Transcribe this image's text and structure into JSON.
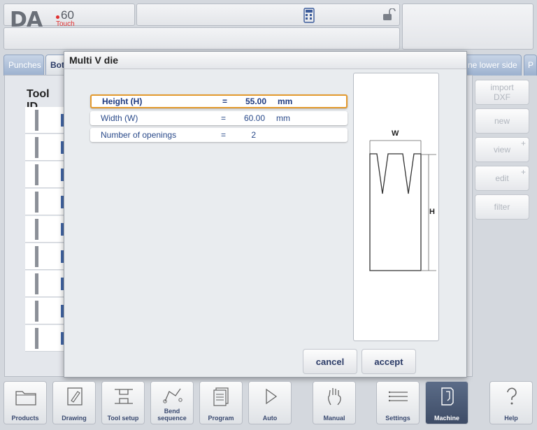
{
  "header": {
    "logo_main": "DA",
    "logo_model": "60",
    "logo_sub": "Touch"
  },
  "tabs": [
    {
      "label": "Punches"
    },
    {
      "label": "Bottom dies"
    },
    {
      "label": "ne lower side"
    },
    {
      "label": "P"
    }
  ],
  "list": {
    "header": "Tool ID"
  },
  "side_buttons": {
    "import": {
      "line1": "import",
      "line2": "DXF"
    },
    "new": "new",
    "view": "view",
    "edit": "edit",
    "filter": "filter"
  },
  "dialog": {
    "title": "Multi V die",
    "fields": [
      {
        "label": "Height (H)",
        "eq": "=",
        "value": "55.00",
        "unit": "mm"
      },
      {
        "label": "Width (W)",
        "eq": "=",
        "value": "60.00",
        "unit": "mm"
      },
      {
        "label": "Number of openings",
        "eq": "=",
        "value": "2",
        "unit": ""
      }
    ],
    "drawing": {
      "width_label": "W",
      "height_label": "H"
    },
    "cancel": "cancel",
    "accept": "accept"
  },
  "bottom_nav": [
    {
      "label": "Products",
      "icon": "folder-icon"
    },
    {
      "label": "Drawing",
      "icon": "drawing-icon"
    },
    {
      "label": "Tool setup",
      "icon": "tool-setup-icon"
    },
    {
      "label1": "Bend",
      "label2": "sequence",
      "icon": "bend-sequence-icon"
    },
    {
      "label": "Program",
      "icon": "program-icon"
    },
    {
      "label": "Auto",
      "icon": "play-icon"
    },
    {
      "label": "Manual",
      "icon": "hand-icon"
    },
    {
      "label": "Settings",
      "icon": "settings-icon"
    },
    {
      "label": "Machine",
      "icon": "machine-icon",
      "active": true
    },
    {
      "label": "Help",
      "icon": "help-icon"
    }
  ]
}
